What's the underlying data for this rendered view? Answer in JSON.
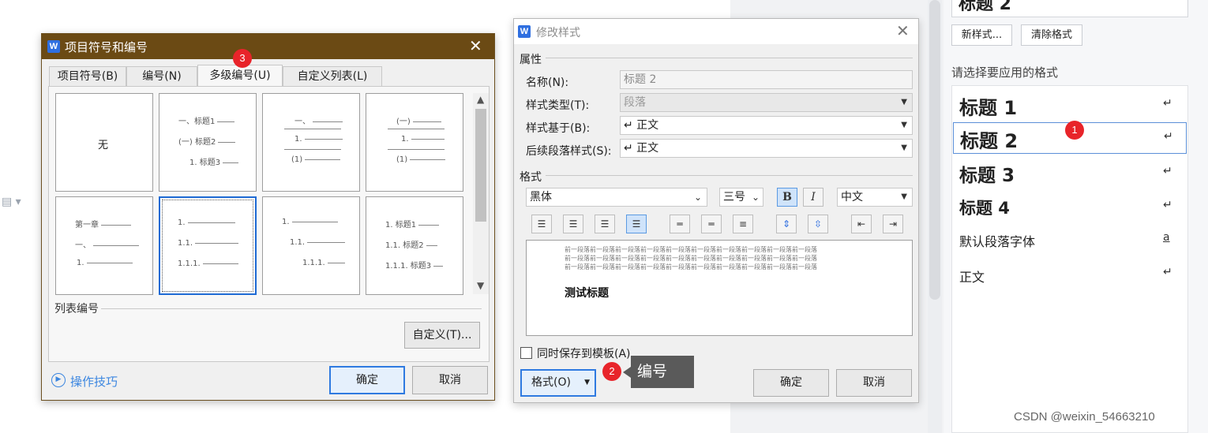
{
  "dialog1": {
    "title": "项目符号和编号",
    "close_glyph": "✕",
    "tabs": [
      "项目符号(B)",
      "编号(N)",
      "多级编号(U)",
      "自定义列表(L)"
    ],
    "badge": "3",
    "cells": {
      "none": "无",
      "c2": [
        "一、标题1",
        "(一) 标题2",
        "1. 标题3"
      ],
      "c3": [
        "一、",
        "1.",
        "(1)"
      ],
      "c4": [
        "(一)",
        "1.",
        "(1)"
      ],
      "c5": [
        "第一章",
        "一、",
        "1."
      ],
      "c6": [
        "1.",
        "1.1.",
        "1.1.1."
      ],
      "c7": [
        "1.",
        "1.1.",
        "1.1.1."
      ],
      "c8": [
        "1. 标题1",
        "1.1. 标题2",
        "1.1.1. 标题3"
      ]
    },
    "section_label": "列表编号",
    "customize_button": "自定义(T)...",
    "tips_link": "操作技巧",
    "ok_button": "确定",
    "cancel_button": "取消"
  },
  "dialog2": {
    "title": "修改样式",
    "close_glyph": "✕",
    "attributes_label": "属性",
    "name_label": "名称(N):",
    "name_value": "标题 2",
    "style_type_label": "样式类型(T):",
    "style_type_value": "段落",
    "based_on_label": "样式基于(B):",
    "based_on_value": "↵ 正文",
    "next_style_label": "后续段落样式(S):",
    "next_style_value": "↵ 正文",
    "format_label": "格式",
    "font_value": "黑体",
    "size_value": "三号",
    "bold_glyph": "B",
    "italic_glyph": "I",
    "lang_value": "中文",
    "preview_prev": "前一段落前一段落前一段落前一段落前一段落前一段落前一段落前一段落前一段落前一段落",
    "preview_heading": "测试标题",
    "save_template_label": "同时保存到模板(A)",
    "format_button": "格式(O)",
    "badge": "2",
    "ok_button": "确定",
    "cancel_button": "取消"
  },
  "tooltip": "编号",
  "right_panel": {
    "current_style": "标题 2",
    "new_style_button": "新样式...",
    "clear_format_button": "清除格式",
    "prompt": "请选择要应用的格式",
    "badge": "1",
    "styles": [
      {
        "name": "标题 1",
        "mark": "↵"
      },
      {
        "name": "标题 2",
        "mark": "↵"
      },
      {
        "name": "标题 3",
        "mark": "↵"
      },
      {
        "name": "标题 4",
        "mark": "↵"
      },
      {
        "name": "默认段落字体",
        "mark": "a"
      },
      {
        "name": "正文",
        "mark": "↵"
      }
    ]
  },
  "watermark": "CSDN @weixin_54663210",
  "colors": {
    "dialog1_title": "#6b4a14",
    "accent": "#2f7ae0",
    "badge": "#e8242a"
  }
}
